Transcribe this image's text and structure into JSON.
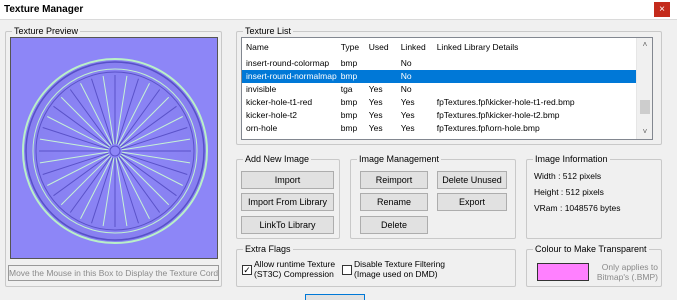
{
  "window": {
    "title": "Texture Manager",
    "close_glyph": "×"
  },
  "preview": {
    "legend": "Texture Preview",
    "hint": "Move the Mouse in this Box to Display the Texture Cord"
  },
  "texture_list": {
    "legend": "Texture List",
    "columns": [
      "Name",
      "Type",
      "Used",
      "Linked",
      "Linked Library Details"
    ],
    "rows": [
      {
        "name": "insert-round-colormap",
        "type": "bmp",
        "used": "",
        "linked": "No",
        "details": ""
      },
      {
        "name": "insert-round-normalmap",
        "type": "bmp",
        "used": "",
        "linked": "No",
        "details": "",
        "selected": true
      },
      {
        "name": "invisible",
        "type": "tga",
        "used": "Yes",
        "linked": "No",
        "details": ""
      },
      {
        "name": "kicker-hole-t1-red",
        "type": "bmp",
        "used": "Yes",
        "linked": "Yes",
        "details": "fpTextures.fpl\\kicker-hole-t1-red.bmp"
      },
      {
        "name": "kicker-hole-t2",
        "type": "bmp",
        "used": "Yes",
        "linked": "Yes",
        "details": "fpTextures.fpl\\kicker-hole-t2.bmp"
      },
      {
        "name": "orn-hole",
        "type": "bmp",
        "used": "Yes",
        "linked": "Yes",
        "details": "fpTextures.fpl\\orn-hole.bmp"
      }
    ],
    "scroll_up": "˄",
    "scroll_down": "˅"
  },
  "add_new_image": {
    "legend": "Add New Image",
    "import": "Import",
    "import_from_library": "Import From Library",
    "link_to_library": "LinkTo Library"
  },
  "image_management": {
    "legend": "Image Management",
    "reimport": "Reimport",
    "delete_unused": "Delete Unused",
    "rename": "Rename",
    "export": "Export",
    "delete": "Delete"
  },
  "image_information": {
    "legend": "Image Information",
    "width": "Width :  512 pixels",
    "height": "Height :  512 pixels",
    "vram": "VRam :  1048576 bytes"
  },
  "extra_flags": {
    "legend": "Extra Flags",
    "allow_compression_line1": "Allow runtime Texture",
    "allow_compression_line2": "(ST3C) Compression",
    "allow_compression_checked": "✓",
    "disable_filtering_line1": "Disable Texture Filtering",
    "disable_filtering_line2": "(Image used on DMD)"
  },
  "transparent_color": {
    "legend": "Colour to Make Transparent",
    "swatch_color": "#ff80ff",
    "note_line1": "Only applies to",
    "note_line2": "Bitmap's (.BMP)"
  },
  "colors": {
    "selection": "#0078d7",
    "preview_bg": "#8d86f7",
    "close_button": "#c42b1c"
  }
}
